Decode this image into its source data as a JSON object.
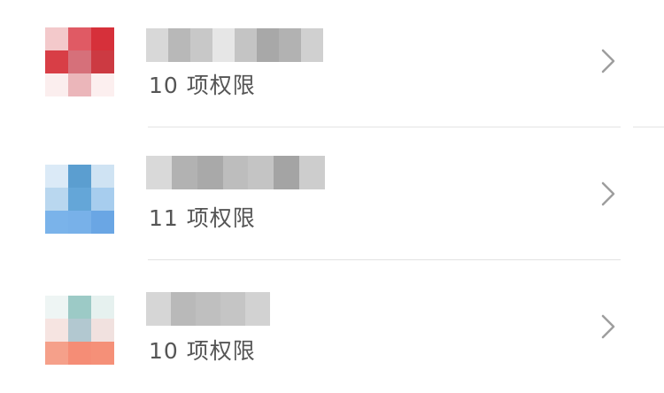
{
  "apps": [
    {
      "permission_text": "10 项权限",
      "icon_colors": [
        "#f3c9cb",
        "#e05a64",
        "#d6303a",
        "#d83e46",
        "#d6707a",
        "#cc3a42",
        "#fbeeee",
        "#ebb6ba",
        "#fcefef"
      ],
      "name_blur": [
        "#d8d8d8",
        "#b8b8b8",
        "#c8c8c8",
        "#e6e6e6",
        "#c4c4c4",
        "#a8a8a8",
        "#b2b2b2",
        "#d0d0d0"
      ]
    },
    {
      "permission_text": "11 项权限",
      "icon_colors": [
        "#dbeaf7",
        "#5b9ed0",
        "#cfe3f3",
        "#b9d7ef",
        "#64a6d8",
        "#a7cdee",
        "#7ab3ea",
        "#78b1e9",
        "#6aa6e4"
      ],
      "name_blur": [
        "#d9d9d9",
        "#b2b2b2",
        "#a9a9a9",
        "#bdbdbd",
        "#c4c4c4",
        "#a4a4a4",
        "#cdcdcd"
      ]
    },
    {
      "permission_text": "10 项权限",
      "icon_colors": [
        "#eef5f4",
        "#9ccac6",
        "#e6f1ef",
        "#f6e4e1",
        "#b2c8d0",
        "#f1e1df",
        "#f5a08a",
        "#f58d76",
        "#f59078"
      ],
      "name_blur": [
        "#d6d6d6",
        "#b9b9b9",
        "#bfbfbf",
        "#c5c5c5",
        "#d2d2d2"
      ]
    }
  ],
  "chevron_color": "#9e9e9e"
}
